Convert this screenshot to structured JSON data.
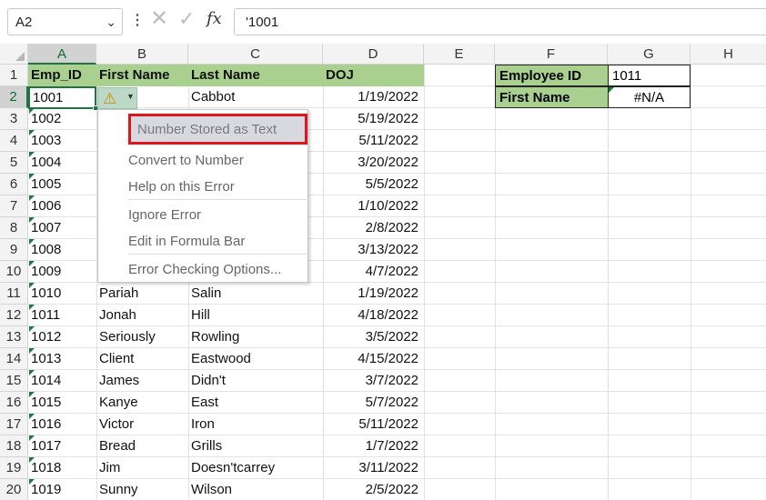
{
  "formula_bar": {
    "name_box": "A2",
    "formula": "'1001",
    "fx": "fx"
  },
  "columns": [
    "A",
    "B",
    "C",
    "D",
    "E",
    "F",
    "G",
    "H"
  ],
  "rows": [
    "1",
    "2",
    "3",
    "4",
    "5",
    "6",
    "7",
    "8",
    "9",
    "10",
    "11",
    "12",
    "13",
    "14",
    "15",
    "16",
    "17",
    "18",
    "19",
    "20"
  ],
  "headers": {
    "emp_id": "Emp_ID",
    "first_name": "First Name",
    "last_name": "Last Name",
    "doj": "DOJ"
  },
  "data_rows": [
    {
      "id": "1001",
      "first": "",
      "last": "Cabbot",
      "doj": "1/19/2022"
    },
    {
      "id": "1002",
      "first": "",
      "last": "",
      "doj": "5/19/2022"
    },
    {
      "id": "1003",
      "first": "",
      "last": "",
      "doj": "5/11/2022"
    },
    {
      "id": "1004",
      "first": "",
      "last": "",
      "doj": "3/20/2022"
    },
    {
      "id": "1005",
      "first": "",
      "last": "",
      "doj": "5/5/2022"
    },
    {
      "id": "1006",
      "first": "",
      "last": "",
      "doj": "1/10/2022"
    },
    {
      "id": "1007",
      "first": "",
      "last": "",
      "doj": "2/8/2022"
    },
    {
      "id": "1008",
      "first": "",
      "last": "",
      "doj": "3/13/2022"
    },
    {
      "id": "1009",
      "first": "",
      "last": "",
      "doj": "4/7/2022"
    },
    {
      "id": "1010",
      "first": "Pariah",
      "last": "Salin",
      "doj": "1/19/2022"
    },
    {
      "id": "1011",
      "first": "Jonah",
      "last": "Hill",
      "doj": "4/18/2022"
    },
    {
      "id": "1012",
      "first": "Seriously",
      "last": "Rowling",
      "doj": "3/5/2022"
    },
    {
      "id": "1013",
      "first": "Client",
      "last": "Eastwood",
      "doj": "4/15/2022"
    },
    {
      "id": "1014",
      "first": "James",
      "last": "Didn't",
      "doj": "3/7/2022"
    },
    {
      "id": "1015",
      "first": "Kanye",
      "last": "East",
      "doj": "5/7/2022"
    },
    {
      "id": "1016",
      "first": "Victor",
      "last": "Iron",
      "doj": "5/11/2022"
    },
    {
      "id": "1017",
      "first": "Bread",
      "last": "Grills",
      "doj": "1/7/2022"
    },
    {
      "id": "1018",
      "first": "Jim",
      "last": "Doesn'tcarrey",
      "doj": "3/11/2022"
    },
    {
      "id": "1019",
      "first": "Sunny",
      "last": "Wilson",
      "doj": "2/5/2022"
    }
  ],
  "lookup": {
    "employee_id_label": "Employee ID",
    "employee_id_value": "1011",
    "first_name_label": "First Name",
    "first_name_value": "#N/A"
  },
  "error_menu": {
    "title": "Number Stored as Text",
    "items": [
      "Convert to Number",
      "Help on this Error",
      "Ignore Error",
      "Edit in Formula Bar",
      "Error Checking Options..."
    ]
  },
  "colors": {
    "header_fill": "#a9d08e",
    "accent_green": "#217346",
    "highlight_red": "#e0151c"
  }
}
